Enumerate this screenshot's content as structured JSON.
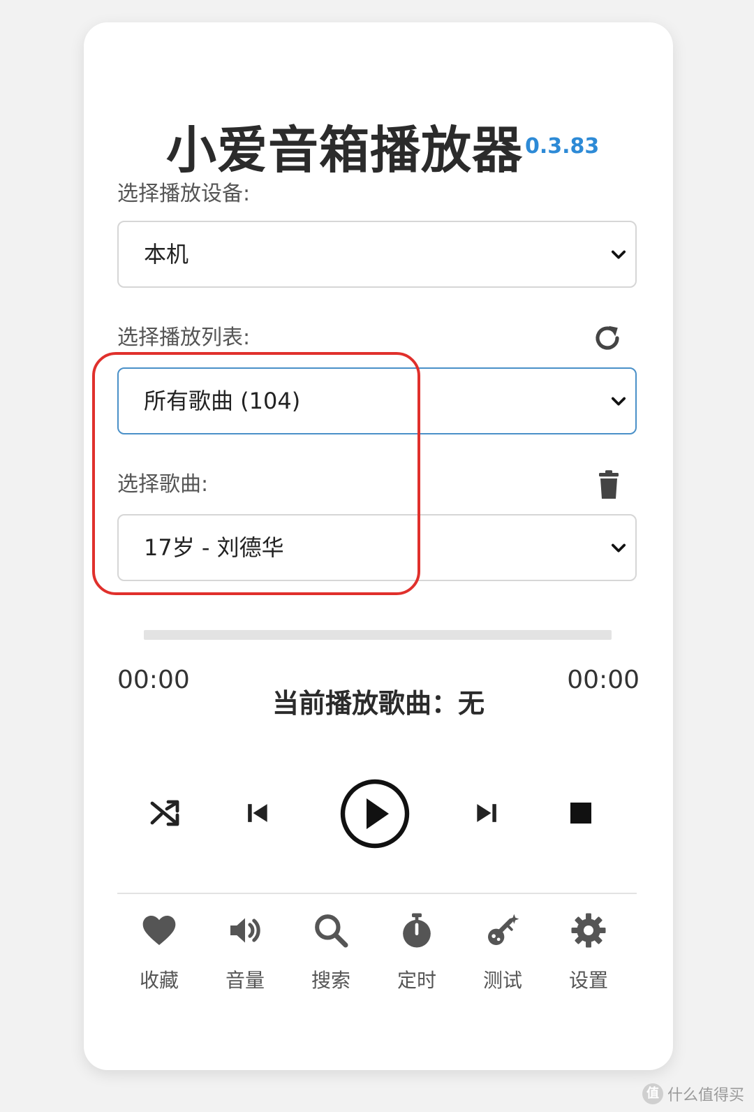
{
  "app": {
    "title": "小爱音箱播放器",
    "version": "0.3.83",
    "accent_color": "#2d8ad6"
  },
  "device": {
    "label": "选择播放设备:",
    "selected": "本机"
  },
  "playlist": {
    "label": "选择播放列表:",
    "selected": "所有歌曲 (104)",
    "refresh_icon": "refresh-icon"
  },
  "song": {
    "label": "选择歌曲:",
    "selected": "17岁 - 刘德华",
    "delete_icon": "trash-icon"
  },
  "player": {
    "progress_fraction": 0,
    "current_time": "00:00",
    "total_time": "00:00",
    "now_playing": "当前播放歌曲：无",
    "controls": [
      "shuffle-icon",
      "previous-icon",
      "play-icon",
      "next-icon",
      "stop-icon"
    ]
  },
  "nav": {
    "items": [
      {
        "label": "收藏",
        "icon": "heart-icon"
      },
      {
        "label": "音量",
        "icon": "volume-icon"
      },
      {
        "label": "搜索",
        "icon": "search-icon"
      },
      {
        "label": "定时",
        "icon": "stopwatch-icon"
      },
      {
        "label": "测试",
        "icon": "test-icon"
      },
      {
        "label": "设置",
        "icon": "gear-icon"
      }
    ]
  },
  "highlight_color": "#e0302c",
  "watermark": {
    "badge": "值",
    "text": "什么值得买"
  }
}
